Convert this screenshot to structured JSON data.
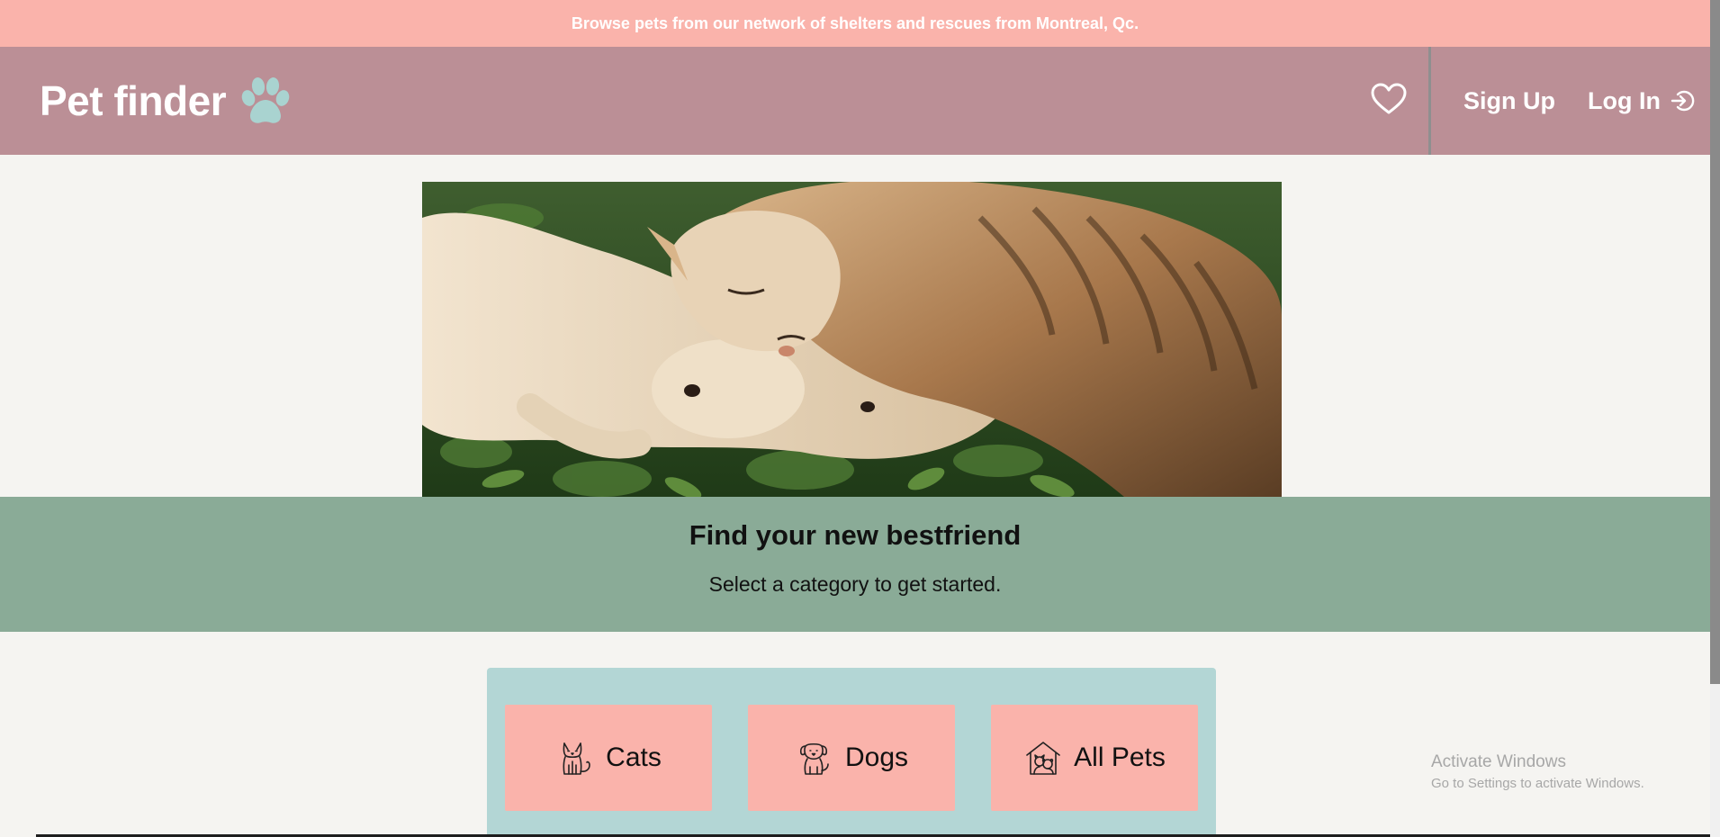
{
  "announcement": {
    "text": "Browse pets from our network of shelters and rescues from Montreal, Qc."
  },
  "header": {
    "logo_text": "Pet finder",
    "logo_icon": "paw-icon",
    "favorites_icon": "heart-icon",
    "signup_label": "Sign Up",
    "login_label": "Log In",
    "login_icon": "login-icon"
  },
  "hero": {
    "image_subject": "cat and dog lying together in grass"
  },
  "tagline": {
    "title": "Find your new bestfriend",
    "subtitle": "Select a category to get started."
  },
  "categories": [
    {
      "label": "Cats",
      "icon": "cat-icon"
    },
    {
      "label": "Dogs",
      "icon": "dog-icon"
    },
    {
      "label": "All Pets",
      "icon": "pet-house-icon"
    }
  ],
  "watermark": {
    "title": "Activate Windows",
    "subtitle": "Go to Settings to activate Windows."
  },
  "colors": {
    "announce_bg": "#fab3ab",
    "header_bg": "#bb8f96",
    "paw_color": "#a9d3d0",
    "band_bg": "#8aab97",
    "panel_bg": "#b3d6d5",
    "button_bg": "#fab3ab",
    "page_bg": "#f5f4f1"
  }
}
